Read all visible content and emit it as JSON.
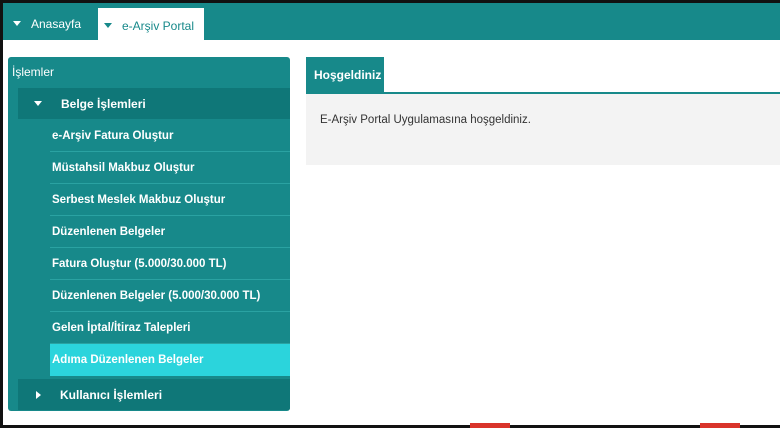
{
  "topnav": {
    "home_label": "Anasayfa",
    "portal_label": "e-Arşiv Portal"
  },
  "sidebar": {
    "title": "İşlemler",
    "group_belge": "Belge İşlemleri",
    "items": [
      {
        "label": "e-Arşiv Fatura Oluştur"
      },
      {
        "label": "Müstahsil Makbuz Oluştur"
      },
      {
        "label": "Serbest Meslek Makbuz Oluştur"
      },
      {
        "label": "Düzenlenen Belgeler"
      },
      {
        "label": "Fatura Oluştur (5.000/30.000 TL)"
      },
      {
        "label": "Düzenlenen Belgeler (5.000/30.000 TL)"
      },
      {
        "label": "Gelen İptal/İtiraz Talepleri"
      },
      {
        "label": "Adıma Düzenlenen Belgeler"
      }
    ],
    "active_item": "Adıma Düzenlenen Belgeler",
    "group_kullanici": "Kullanıcı İşlemleri"
  },
  "main": {
    "tab_label": "Hoşgeldiniz",
    "welcome_text": "E-Arşiv Portal Uygulamasına hoşgeldiniz."
  },
  "colors": {
    "primary": "#17898a",
    "active_item": "#2bd4dc"
  }
}
